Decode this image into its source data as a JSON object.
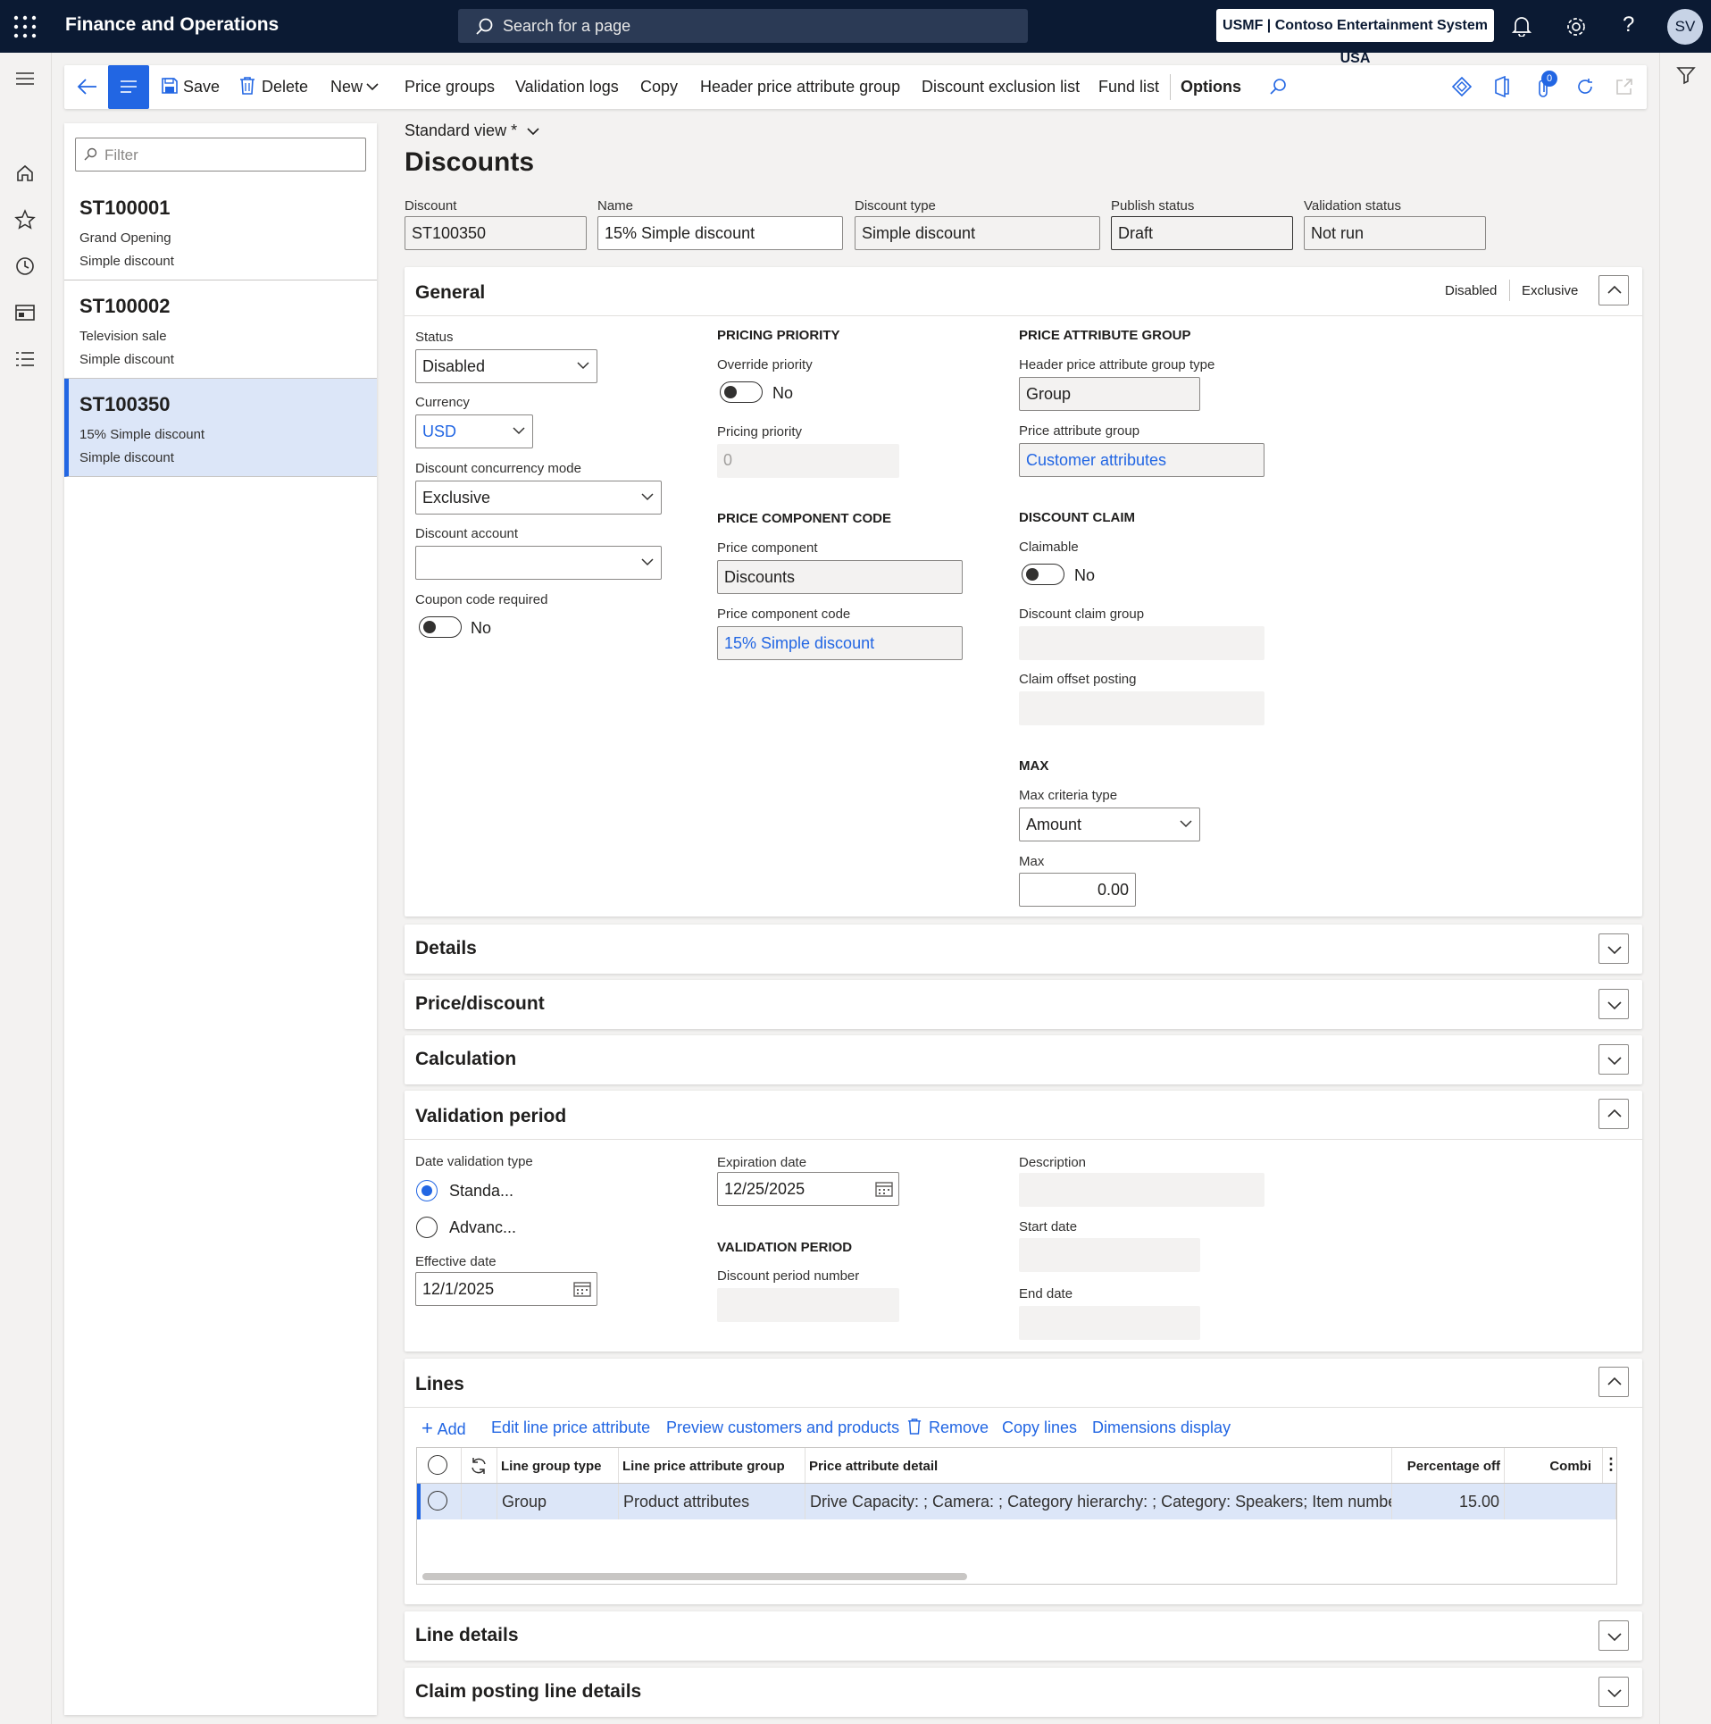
{
  "app": {
    "name": "Finance and Operations",
    "search_placeholder": "Search for a page",
    "company": "USMF | Contoso Entertainment System USA",
    "user_initials": "SV"
  },
  "actionbar": {
    "save": "Save",
    "delete": "Delete",
    "new": "New",
    "price_groups": "Price groups",
    "validation_logs": "Validation logs",
    "copy": "Copy",
    "header_price_attribute_group": "Header price attribute group",
    "discount_exclusion_list": "Discount exclusion list",
    "fund_list": "Fund list",
    "options": "Options",
    "badge_count": "0"
  },
  "list": {
    "filter_placeholder": "Filter",
    "items": [
      {
        "id": "ST100001",
        "name": "Grand Opening",
        "type": "Simple discount"
      },
      {
        "id": "ST100002",
        "name": "Television sale",
        "type": "Simple discount"
      },
      {
        "id": "ST100350",
        "name": "15% Simple discount",
        "type": "Simple discount"
      }
    ]
  },
  "page": {
    "view": "Standard view *",
    "title": "Discounts"
  },
  "header_fields": {
    "discount_label": "Discount",
    "discount_value": "ST100350",
    "name_label": "Name",
    "name_value": "15% Simple discount",
    "type_label": "Discount type",
    "type_value": "Simple discount",
    "publish_label": "Publish status",
    "publish_value": "Draft",
    "validation_label": "Validation status",
    "validation_value": "Not run"
  },
  "general": {
    "title": "General",
    "summary_status": "Disabled",
    "summary_mode": "Exclusive",
    "status_label": "Status",
    "status_value": "Disabled",
    "currency_label": "Currency",
    "currency_value": "USD",
    "concurrency_label": "Discount concurrency mode",
    "concurrency_value": "Exclusive",
    "account_label": "Discount account",
    "account_value": "",
    "coupon_label": "Coupon code required",
    "coupon_value": "No",
    "pricing_priority_header": "PRICING PRIORITY",
    "override_label": "Override priority",
    "override_value": "No",
    "priority_label": "Pricing priority",
    "priority_value": "0",
    "price_component_header": "PRICE COMPONENT CODE",
    "component_label": "Price component",
    "component_value": "Discounts",
    "component_code_label": "Price component code",
    "component_code_value": "15% Simple discount",
    "pag_header": "PRICE ATTRIBUTE GROUP",
    "pag_type_label": "Header price attribute group type",
    "pag_type_value": "Group",
    "pag_label": "Price attribute group",
    "pag_value": "Customer attributes",
    "claim_header": "DISCOUNT CLAIM",
    "claimable_label": "Claimable",
    "claimable_value": "No",
    "claim_group_label": "Discount claim group",
    "claim_offset_label": "Claim offset posting",
    "max_header": "MAX",
    "max_criteria_label": "Max criteria type",
    "max_criteria_value": "Amount",
    "max_label": "Max",
    "max_value": "0.00"
  },
  "sections": {
    "details": "Details",
    "price_discount": "Price/discount",
    "calculation": "Calculation",
    "line_details": "Line details",
    "claim_posting": "Claim posting line details"
  },
  "validation": {
    "title": "Validation period",
    "date_type_label": "Date validation type",
    "opt_standard": "Standa...",
    "opt_advanced": "Advanc...",
    "effective_label": "Effective date",
    "effective_value": "12/1/2025",
    "expiration_label": "Expiration date",
    "expiration_value": "12/25/2025",
    "period_header": "VALIDATION PERIOD",
    "period_number_label": "Discount period number",
    "description_label": "Description",
    "start_label": "Start date",
    "end_label": "End date"
  },
  "lines": {
    "title": "Lines",
    "add": "Add",
    "edit_attr": "Edit line price attribute",
    "preview": "Preview customers and products",
    "remove": "Remove",
    "copy_lines": "Copy lines",
    "dimensions": "Dimensions display",
    "columns": [
      "Line group type",
      "Line price attribute group",
      "Price attribute detail",
      "Percentage off",
      "Combi"
    ],
    "rows": [
      {
        "group_type": "Group",
        "attr_group": "Product attributes",
        "detail": "Drive Capacity: ; Camera: ; Category hierarchy: ; Category: Speakers; Item number: ;",
        "pct": "15.00"
      }
    ]
  }
}
